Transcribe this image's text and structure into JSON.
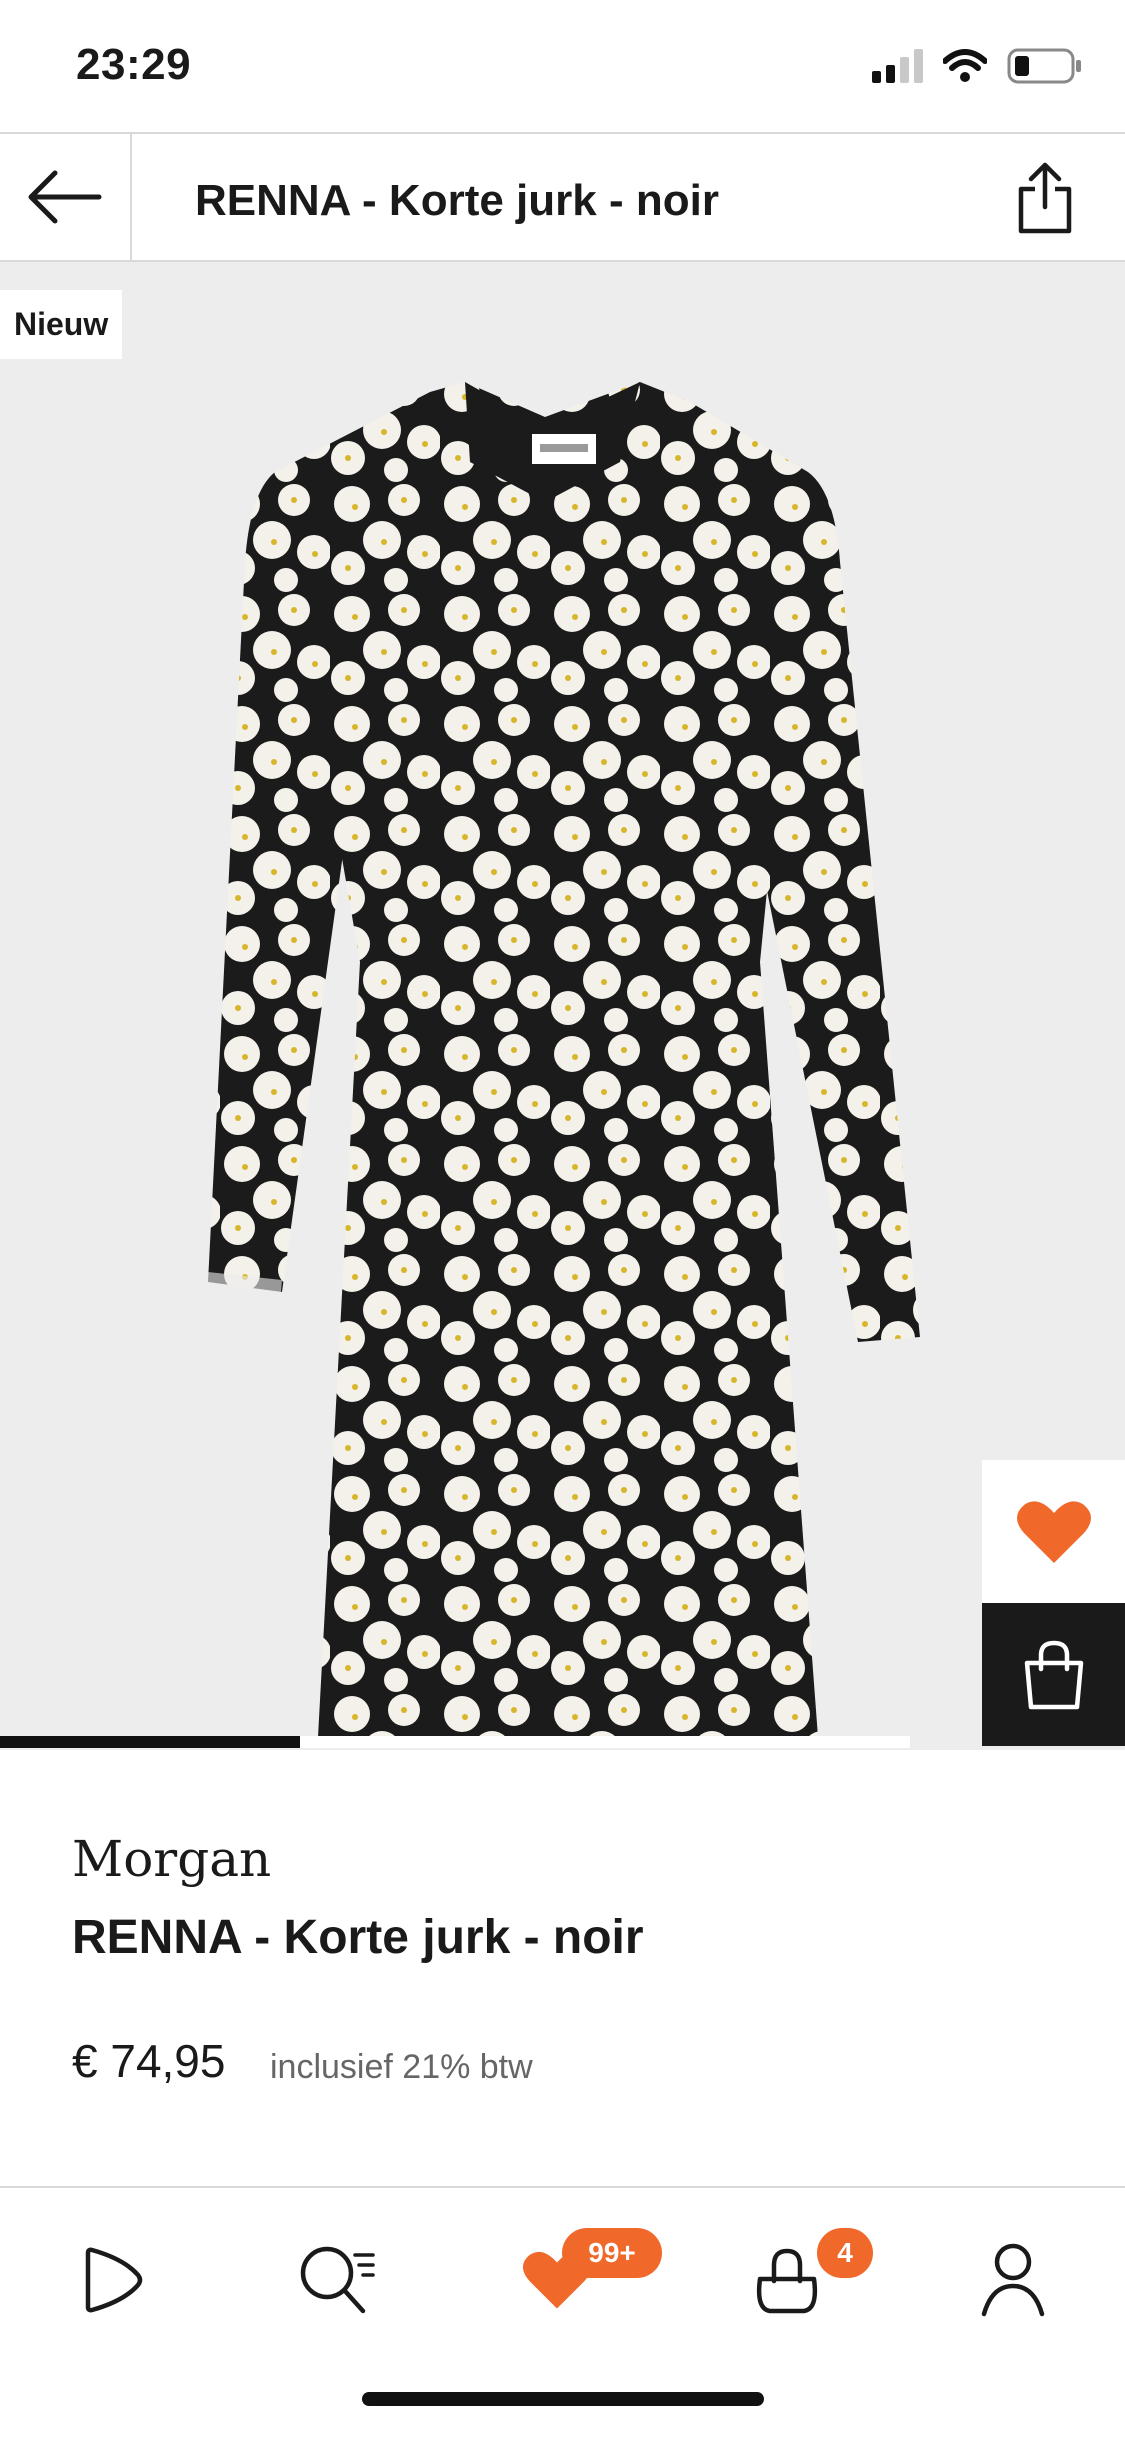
{
  "status_bar": {
    "time": "23:29"
  },
  "header": {
    "title": "RENNA - Korte jurk - noir"
  },
  "hero": {
    "badge": "Nieuw",
    "carousel_progress": 0.33
  },
  "product": {
    "brand": "Morgan",
    "name": "RENNA - Korte jurk - noir",
    "price": "€ 74,95",
    "vat_note": "inclusief 21% btw"
  },
  "bottom_nav": {
    "wishlist_badge": "99+",
    "cart_badge": "4"
  },
  "colors": {
    "accent": "#f0692b",
    "dark": "#1a1a1a",
    "image_bg": "#ededed"
  },
  "icons": [
    "back-arrow-icon",
    "share-icon",
    "heart-icon",
    "shopping-bag-icon",
    "home-icon",
    "search-icon",
    "wishlist-icon",
    "cart-icon",
    "account-icon"
  ]
}
